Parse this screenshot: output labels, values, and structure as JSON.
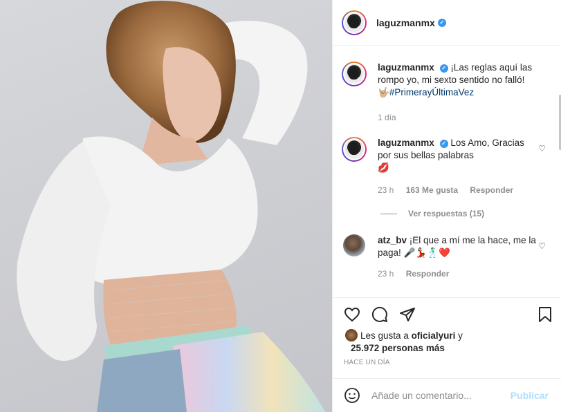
{
  "post": {
    "author": "laguzmanmx",
    "verified_icon": "verified-badge-icon"
  },
  "caption": {
    "author": "laguzmanmx",
    "text": "¡Las reglas aquí las rompo yo, mi sexto sentido no falló! ",
    "emoji": "🤟🏼",
    "hashtag": "#PrimerayÚltimaVez",
    "time": "1 día"
  },
  "comments": [
    {
      "author": "laguzmanmx",
      "text": "Los Amo, Gracias por sus bellas palabras",
      "emoji": "💋",
      "time": "23 h",
      "likes": "163 Me gusta",
      "reply_label": "Responder",
      "view_replies": "Ver respuestas (15)"
    },
    {
      "author": "atz_bv",
      "text": "¡El que a mí me la hace, me la paga! ",
      "emoji": "🎤💃🏻🕺🏻❤️",
      "time": "23 h",
      "reply_label": "Responder"
    }
  ],
  "likes": {
    "prefix": "Les gusta a ",
    "user": "oficialyuri",
    "suffix": " y",
    "count": "25.972 personas más"
  },
  "timestamp": "HACE UN DÍA",
  "comment_box": {
    "placeholder": "Añade un comentario...",
    "post_label": "Publicar"
  },
  "colors": {
    "accent": "#3897f0",
    "muted": "#8e8e8e",
    "hashtag": "#00376b",
    "post_disabled": "#b2dffc"
  }
}
